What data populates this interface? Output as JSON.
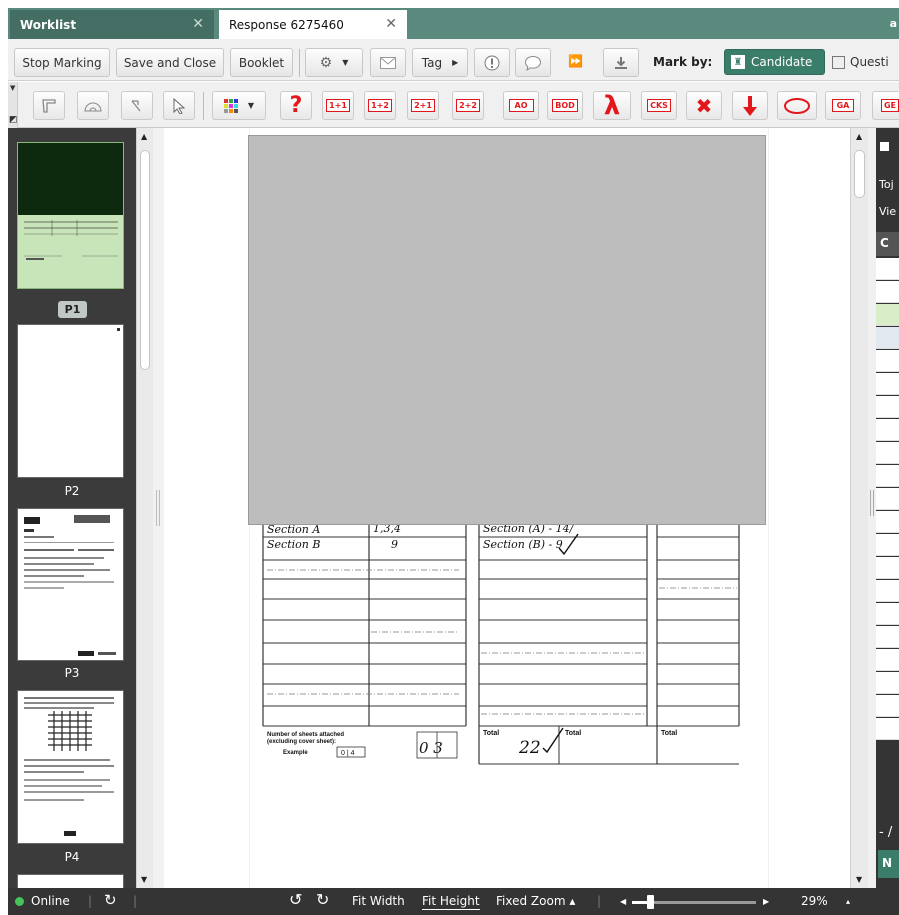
{
  "tabs": [
    {
      "label": "Worklist",
      "active": false
    },
    {
      "label": "Response 6275460",
      "active": true
    }
  ],
  "toolbar": {
    "stop_marking": "Stop Marking",
    "save_and_close": "Save and Close",
    "booklet": "Booklet",
    "tag": "Tag",
    "mark_by_label": "Mark by:",
    "candidate": "Candidate",
    "question": "Questi"
  },
  "annotation_tools": {
    "stamps": [
      "1+1",
      "1+2",
      "2+1",
      "2+2",
      "AO",
      "BOD",
      "CKS",
      "GA",
      "GE"
    ],
    "symbols": [
      "?",
      "λ",
      "✖",
      "⬇",
      "⬭"
    ]
  },
  "thumbnails": [
    {
      "label": "P1",
      "selected": true
    },
    {
      "label": "P2",
      "selected": false
    },
    {
      "label": "P3",
      "selected": false
    },
    {
      "label": "P4",
      "selected": false
    }
  ],
  "document": {
    "sections": [
      "Section A",
      "Section B"
    ],
    "col2": [
      "1,3,4",
      "9"
    ],
    "col3": [
      "Section (A) - 14/",
      "Section (B) - 9"
    ],
    "sheets_label_1": "Number of sheets attached",
    "sheets_label_2": "(excluding cover sheet):",
    "example_label": "Example",
    "example_value": "0 | 4",
    "sheets_value": "0 3",
    "total_1": "Total",
    "total_value": "22",
    "total_2": "Total",
    "total_3": "Total"
  },
  "right_panel": {
    "row1": "Toj",
    "row2": "Vie",
    "header": "C",
    "bottom": "- /",
    "nav": "N"
  },
  "statusbar": {
    "online": "Online",
    "fit_width": "Fit Width",
    "fit_height": "Fit Height",
    "fixed_zoom": "Fixed Zoom ▴",
    "zoom_percent": "29%",
    "zoom_level": 0.15
  },
  "colors": {
    "tab_bar": "#5a8a7e",
    "accent": "#3a7d6a",
    "stamp_red": "#e3171b",
    "thumb_bg": "#3b3b3b",
    "status_bg": "#343434"
  }
}
